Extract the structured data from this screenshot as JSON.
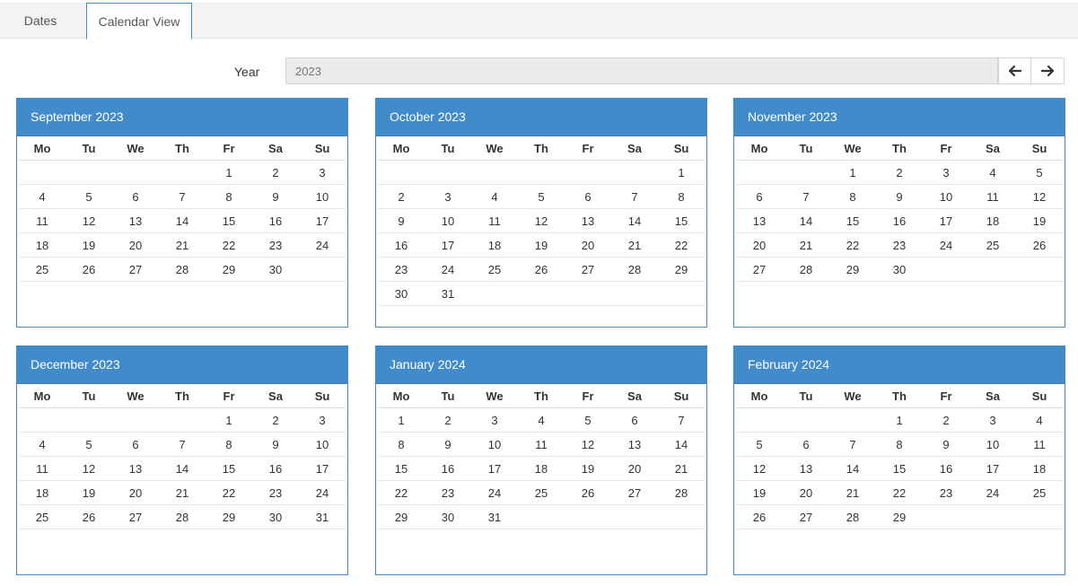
{
  "tabs": [
    {
      "label": "Dates",
      "active": false
    },
    {
      "label": "Calendar View",
      "active": true
    }
  ],
  "year": {
    "label": "Year",
    "value": "2023"
  },
  "nav": {
    "prev_icon": "arrow-left-icon",
    "next_icon": "arrow-right-icon"
  },
  "colors": {
    "header_bg": "#428bca",
    "border": "#3f8bc6"
  },
  "weekdays": [
    "Mo",
    "Tu",
    "We",
    "Th",
    "Fr",
    "Sa",
    "Su"
  ],
  "months": [
    {
      "title": "September 2023",
      "weeks": [
        [
          "",
          "",
          "",
          "",
          "1",
          "2",
          "3"
        ],
        [
          "4",
          "5",
          "6",
          "7",
          "8",
          "9",
          "10"
        ],
        [
          "11",
          "12",
          "13",
          "14",
          "15",
          "16",
          "17"
        ],
        [
          "18",
          "19",
          "20",
          "21",
          "22",
          "23",
          "24"
        ],
        [
          "25",
          "26",
          "27",
          "28",
          "29",
          "30",
          ""
        ]
      ]
    },
    {
      "title": "October 2023",
      "weeks": [
        [
          "",
          "",
          "",
          "",
          "",
          "",
          "1"
        ],
        [
          "2",
          "3",
          "4",
          "5",
          "6",
          "7",
          "8"
        ],
        [
          "9",
          "10",
          "11",
          "12",
          "13",
          "14",
          "15"
        ],
        [
          "16",
          "17",
          "18",
          "19",
          "20",
          "21",
          "22"
        ],
        [
          "23",
          "24",
          "25",
          "26",
          "27",
          "28",
          "29"
        ],
        [
          "30",
          "31",
          "",
          "",
          "",
          "",
          ""
        ]
      ]
    },
    {
      "title": "November 2023",
      "weeks": [
        [
          "",
          "",
          "1",
          "2",
          "3",
          "4",
          "5"
        ],
        [
          "6",
          "7",
          "8",
          "9",
          "10",
          "11",
          "12"
        ],
        [
          "13",
          "14",
          "15",
          "16",
          "17",
          "18",
          "19"
        ],
        [
          "20",
          "21",
          "22",
          "23",
          "24",
          "25",
          "26"
        ],
        [
          "27",
          "28",
          "29",
          "30",
          "",
          "",
          ""
        ]
      ]
    },
    {
      "title": "December 2023",
      "weeks": [
        [
          "",
          "",
          "",
          "",
          "1",
          "2",
          "3"
        ],
        [
          "4",
          "5",
          "6",
          "7",
          "8",
          "9",
          "10"
        ],
        [
          "11",
          "12",
          "13",
          "14",
          "15",
          "16",
          "17"
        ],
        [
          "18",
          "19",
          "20",
          "21",
          "22",
          "23",
          "24"
        ],
        [
          "25",
          "26",
          "27",
          "28",
          "29",
          "30",
          "31"
        ]
      ]
    },
    {
      "title": "January 2024",
      "weeks": [
        [
          "1",
          "2",
          "3",
          "4",
          "5",
          "6",
          "7"
        ],
        [
          "8",
          "9",
          "10",
          "11",
          "12",
          "13",
          "14"
        ],
        [
          "15",
          "16",
          "17",
          "18",
          "19",
          "20",
          "21"
        ],
        [
          "22",
          "23",
          "24",
          "25",
          "26",
          "27",
          "28"
        ],
        [
          "29",
          "30",
          "31",
          "",
          "",
          "",
          ""
        ]
      ]
    },
    {
      "title": "February 2024",
      "weeks": [
        [
          "",
          "",
          "",
          "1",
          "2",
          "3",
          "4"
        ],
        [
          "5",
          "6",
          "7",
          "8",
          "9",
          "10",
          "11"
        ],
        [
          "12",
          "13",
          "14",
          "15",
          "16",
          "17",
          "18"
        ],
        [
          "19",
          "20",
          "21",
          "22",
          "23",
          "24",
          "25"
        ],
        [
          "26",
          "27",
          "28",
          "29",
          "",
          "",
          ""
        ]
      ]
    }
  ]
}
